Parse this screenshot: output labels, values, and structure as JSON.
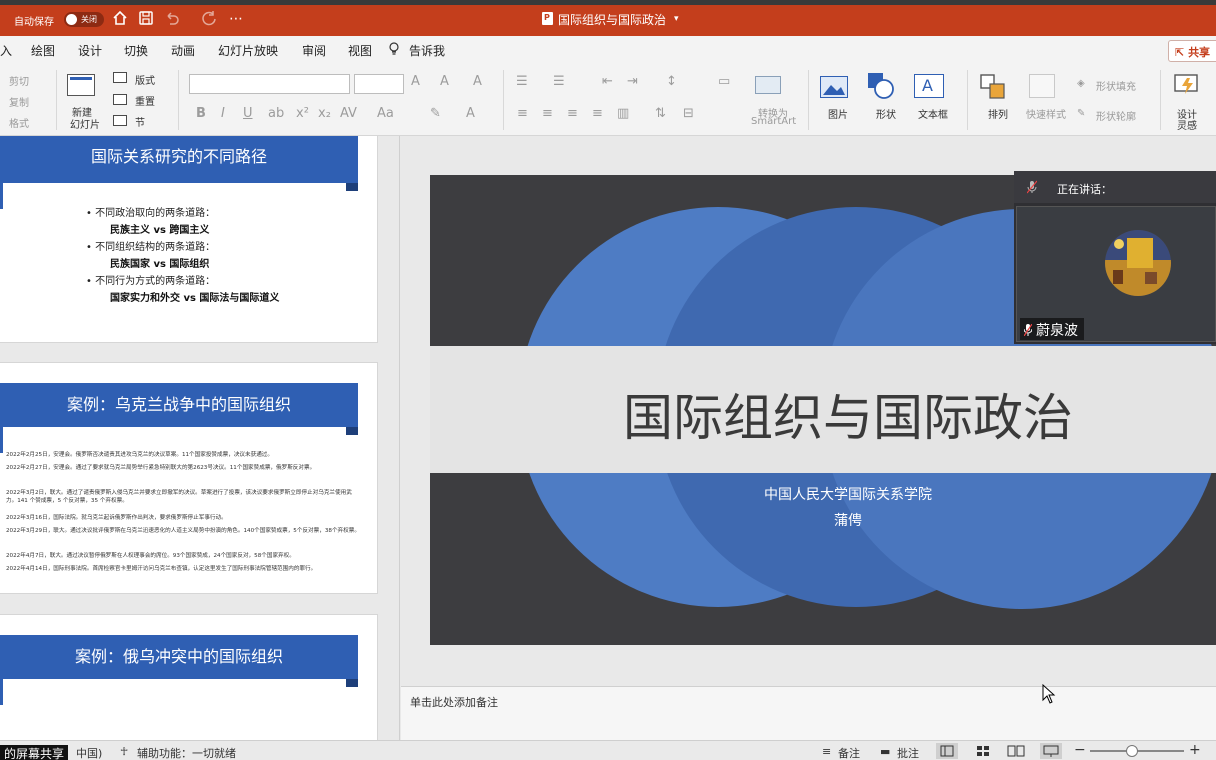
{
  "titlebar": {
    "autosave_label": "自动保存",
    "autosave_state": "关闭",
    "document_title": "国际组织与国际政治",
    "accent_color": "#c43e1c"
  },
  "menu": {
    "tabs": [
      "入",
      "绘图",
      "设计",
      "切换",
      "动画",
      "幻灯片放映",
      "审阅",
      "视图"
    ],
    "tell_me": "告诉我",
    "share": "共享"
  },
  "ribbon": {
    "clipboard": {
      "cut": "剪切",
      "copy": "复制",
      "format": "格式"
    },
    "new_slide": {
      "line1": "新建",
      "line2": "幻灯片"
    },
    "layout": "版式",
    "reset": "重置",
    "section": "节",
    "smartart": {
      "line1": "转换为",
      "line2": "SmartArt"
    },
    "picture": "图片",
    "shape": "形状",
    "textbox": "文本框",
    "arrange": "排列",
    "quick_styles": "快速样式",
    "shape_fill": "形状填充",
    "shape_outline": "形状轮廓",
    "designer": {
      "line1": "设计",
      "line2": "灵感"
    }
  },
  "thumbnails": {
    "slide1": {
      "title": "国际关系研究的不同路径",
      "bullets": [
        {
          "label": "• 不同政治取向的两条道路：",
          "sub": "民族主义 vs 跨国主义"
        },
        {
          "label": "• 不同组织结构的两条道路：",
          "sub": "民族国家 vs 国际组织"
        },
        {
          "label": "• 不同行为方式的两条道路：",
          "sub": "国家实力和外交 vs 国际法与国际道义"
        }
      ]
    },
    "slide2": {
      "title": "案例：乌克兰战争中的国际组织",
      "lines": [
        "2022年2月25日，安理会。俄罗斯否决谴责其进攻乌克兰的决议草案。11个国家投赞成票，决议未获通过。",
        "2022年2月27日，安理会。通过了要求就乌克兰局势举行紧急特别联大的第2623号决议。11个国家赞成票，俄罗斯反对票。",
        "2022年3月2日，联大。通过了谴责俄罗斯入侵乌克兰并要求立即撤军的决议。草案进行了投票，该决议要求俄罗斯立即停止对乌克兰使用武力。141 个赞成票，5 个反对票，35 个弃权票。",
        "2022年3月16日，国际法院。就乌克兰起诉俄罗斯作出判决，要求俄罗斯停止军事行动。",
        "2022年3月29日，联大。通过决议批评俄罗斯在乌克兰迅速恶化的人道主义局势中扮演的角色。140个国家赞成票，5个反对票，38个弃权票。",
        "2022年4月7日，联大。通过决议暂停俄罗斯在人权理事会的席位。93个国家赞成，24个国家反对，58个国家弃权。",
        "2022年4月14日，国际刑事法院。首席检察官卡里姆汗访问乌克兰布查镇，认定这里发生了国际刑事法院管辖范围内的罪行。"
      ]
    },
    "slide3": {
      "title": "案例：俄乌冲突中的国际组织"
    }
  },
  "slide": {
    "title": "国际组织与国际政治",
    "subtitle_line1": "中国人民大学国际关系学院",
    "subtitle_line2": "蒲俜"
  },
  "notes": {
    "placeholder": "单击此处添加备注"
  },
  "meeting": {
    "speaking_label": "正在讲话：",
    "speaker_name": "蔚泉波"
  },
  "statusbar": {
    "screen_share": "的屏幕共享",
    "language_partial": "中国)",
    "accessibility": "辅助功能：一切就绪",
    "notes_btn": "备注",
    "comments_btn": "批注"
  }
}
